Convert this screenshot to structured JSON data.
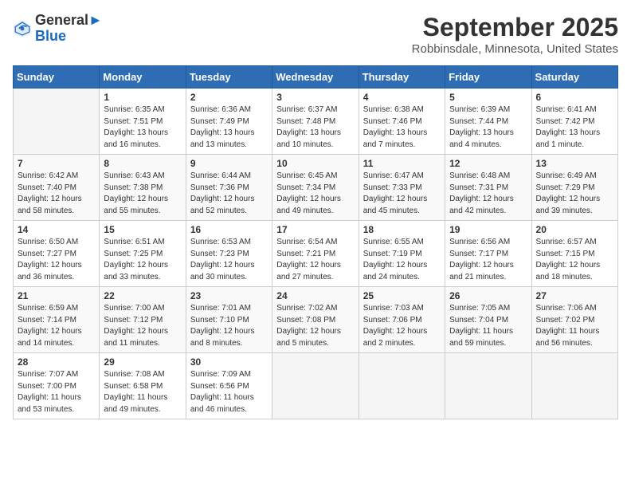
{
  "header": {
    "logo_line1": "General",
    "logo_line2": "Blue",
    "month": "September 2025",
    "location": "Robbinsdale, Minnesota, United States"
  },
  "days_of_week": [
    "Sunday",
    "Monday",
    "Tuesday",
    "Wednesday",
    "Thursday",
    "Friday",
    "Saturday"
  ],
  "weeks": [
    [
      {
        "day": "",
        "info": ""
      },
      {
        "day": "1",
        "info": "Sunrise: 6:35 AM\nSunset: 7:51 PM\nDaylight: 13 hours\nand 16 minutes."
      },
      {
        "day": "2",
        "info": "Sunrise: 6:36 AM\nSunset: 7:49 PM\nDaylight: 13 hours\nand 13 minutes."
      },
      {
        "day": "3",
        "info": "Sunrise: 6:37 AM\nSunset: 7:48 PM\nDaylight: 13 hours\nand 10 minutes."
      },
      {
        "day": "4",
        "info": "Sunrise: 6:38 AM\nSunset: 7:46 PM\nDaylight: 13 hours\nand 7 minutes."
      },
      {
        "day": "5",
        "info": "Sunrise: 6:39 AM\nSunset: 7:44 PM\nDaylight: 13 hours\nand 4 minutes."
      },
      {
        "day": "6",
        "info": "Sunrise: 6:41 AM\nSunset: 7:42 PM\nDaylight: 13 hours\nand 1 minute."
      }
    ],
    [
      {
        "day": "7",
        "info": "Sunrise: 6:42 AM\nSunset: 7:40 PM\nDaylight: 12 hours\nand 58 minutes."
      },
      {
        "day": "8",
        "info": "Sunrise: 6:43 AM\nSunset: 7:38 PM\nDaylight: 12 hours\nand 55 minutes."
      },
      {
        "day": "9",
        "info": "Sunrise: 6:44 AM\nSunset: 7:36 PM\nDaylight: 12 hours\nand 52 minutes."
      },
      {
        "day": "10",
        "info": "Sunrise: 6:45 AM\nSunset: 7:34 PM\nDaylight: 12 hours\nand 49 minutes."
      },
      {
        "day": "11",
        "info": "Sunrise: 6:47 AM\nSunset: 7:33 PM\nDaylight: 12 hours\nand 45 minutes."
      },
      {
        "day": "12",
        "info": "Sunrise: 6:48 AM\nSunset: 7:31 PM\nDaylight: 12 hours\nand 42 minutes."
      },
      {
        "day": "13",
        "info": "Sunrise: 6:49 AM\nSunset: 7:29 PM\nDaylight: 12 hours\nand 39 minutes."
      }
    ],
    [
      {
        "day": "14",
        "info": "Sunrise: 6:50 AM\nSunset: 7:27 PM\nDaylight: 12 hours\nand 36 minutes."
      },
      {
        "day": "15",
        "info": "Sunrise: 6:51 AM\nSunset: 7:25 PM\nDaylight: 12 hours\nand 33 minutes."
      },
      {
        "day": "16",
        "info": "Sunrise: 6:53 AM\nSunset: 7:23 PM\nDaylight: 12 hours\nand 30 minutes."
      },
      {
        "day": "17",
        "info": "Sunrise: 6:54 AM\nSunset: 7:21 PM\nDaylight: 12 hours\nand 27 minutes."
      },
      {
        "day": "18",
        "info": "Sunrise: 6:55 AM\nSunset: 7:19 PM\nDaylight: 12 hours\nand 24 minutes."
      },
      {
        "day": "19",
        "info": "Sunrise: 6:56 AM\nSunset: 7:17 PM\nDaylight: 12 hours\nand 21 minutes."
      },
      {
        "day": "20",
        "info": "Sunrise: 6:57 AM\nSunset: 7:15 PM\nDaylight: 12 hours\nand 18 minutes."
      }
    ],
    [
      {
        "day": "21",
        "info": "Sunrise: 6:59 AM\nSunset: 7:14 PM\nDaylight: 12 hours\nand 14 minutes."
      },
      {
        "day": "22",
        "info": "Sunrise: 7:00 AM\nSunset: 7:12 PM\nDaylight: 12 hours\nand 11 minutes."
      },
      {
        "day": "23",
        "info": "Sunrise: 7:01 AM\nSunset: 7:10 PM\nDaylight: 12 hours\nand 8 minutes."
      },
      {
        "day": "24",
        "info": "Sunrise: 7:02 AM\nSunset: 7:08 PM\nDaylight: 12 hours\nand 5 minutes."
      },
      {
        "day": "25",
        "info": "Sunrise: 7:03 AM\nSunset: 7:06 PM\nDaylight: 12 hours\nand 2 minutes."
      },
      {
        "day": "26",
        "info": "Sunrise: 7:05 AM\nSunset: 7:04 PM\nDaylight: 11 hours\nand 59 minutes."
      },
      {
        "day": "27",
        "info": "Sunrise: 7:06 AM\nSunset: 7:02 PM\nDaylight: 11 hours\nand 56 minutes."
      }
    ],
    [
      {
        "day": "28",
        "info": "Sunrise: 7:07 AM\nSunset: 7:00 PM\nDaylight: 11 hours\nand 53 minutes."
      },
      {
        "day": "29",
        "info": "Sunrise: 7:08 AM\nSunset: 6:58 PM\nDaylight: 11 hours\nand 49 minutes."
      },
      {
        "day": "30",
        "info": "Sunrise: 7:09 AM\nSunset: 6:56 PM\nDaylight: 11 hours\nand 46 minutes."
      },
      {
        "day": "",
        "info": ""
      },
      {
        "day": "",
        "info": ""
      },
      {
        "day": "",
        "info": ""
      },
      {
        "day": "",
        "info": ""
      }
    ]
  ]
}
